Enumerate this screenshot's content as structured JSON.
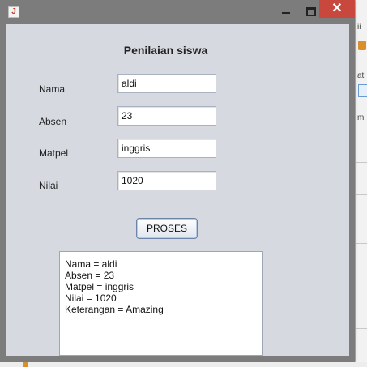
{
  "window": {
    "title": "",
    "icon": "java-app-icon",
    "close_glyph": "✕"
  },
  "form": {
    "heading": "Penilaian siswa",
    "fields": [
      {
        "label": "Nama",
        "value": "aldi"
      },
      {
        "label": "Absen",
        "value": "23"
      },
      {
        "label": "Matpel",
        "value": "inggris"
      },
      {
        "label": "Nilai",
        "value": "1020"
      }
    ],
    "button_label": "PROSES"
  },
  "output": {
    "lines": [
      "Nama = aldi",
      "Absen = 23",
      "Matpel = inggris",
      "Nilai = 1020",
      "Keterangan = Amazing"
    ]
  },
  "background": {
    "fragments": [
      "ii",
      "at",
      "m"
    ]
  },
  "colors": {
    "close_button": "#c9483e",
    "client_bg": "#d6d9df",
    "titlebar": "#7c7c7c"
  }
}
